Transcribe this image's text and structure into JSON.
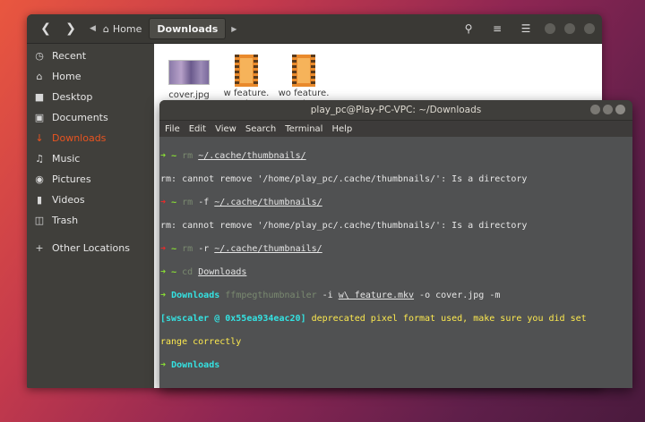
{
  "file_manager": {
    "breadcrumb": {
      "home": "Home",
      "current": "Downloads"
    },
    "sidebar": [
      {
        "icon": "clock-icon",
        "label": "Recent"
      },
      {
        "icon": "home-icon",
        "label": "Home"
      },
      {
        "icon": "folder-icon",
        "label": "Desktop"
      },
      {
        "icon": "document-icon",
        "label": "Documents"
      },
      {
        "icon": "download-icon",
        "label": "Downloads",
        "active": true
      },
      {
        "icon": "music-icon",
        "label": "Music"
      },
      {
        "icon": "camera-icon",
        "label": "Pictures"
      },
      {
        "icon": "video-icon",
        "label": "Videos"
      },
      {
        "icon": "trash-icon",
        "label": "Trash"
      },
      {
        "icon": "plus-icon",
        "label": "Other Locations"
      }
    ],
    "files": [
      {
        "name": "cover.jpg",
        "type": "image"
      },
      {
        "name": "w feature.\nmkv",
        "type": "video"
      },
      {
        "name": "wo feature.\nmkv",
        "type": "video"
      }
    ]
  },
  "terminal": {
    "title": "play_pc@Play-PC-VPC: ~/Downloads",
    "menu": [
      "File",
      "Edit",
      "View",
      "Search",
      "Terminal",
      "Help"
    ],
    "lines": {
      "l1_path": "~/.cache/thumbnails/",
      "l2": "rm: cannot remove '/home/play_pc/.cache/thumbnails/': Is a directory",
      "l3_flag": "-f",
      "l3_path": "~/.cache/thumbnails/",
      "l4": "rm: cannot remove '/home/play_pc/.cache/thumbnails/': Is a directory",
      "l5_flag": "-r",
      "l5_path": "~/.cache/thumbnails/",
      "l6_arg": "Downloads",
      "l7_dir": "Downloads",
      "l7_cmd": "ffmpegthumbnailer",
      "l7_args_a": " -i ",
      "l7_file": "w\\ feature.mkv",
      "l7_args_b": " -o cover.jpg -m",
      "l8_a": "[swscaler @ 0x55ea934eac20]",
      "l8_b": " deprecated pixel format used, make sure you did set",
      "l9": "range correctly",
      "l10_dir": "Downloads"
    },
    "prompt_arrow": "➜",
    "prompt_tilde": "~",
    "cmd_rm": "rm",
    "cmd_cd": "cd"
  }
}
